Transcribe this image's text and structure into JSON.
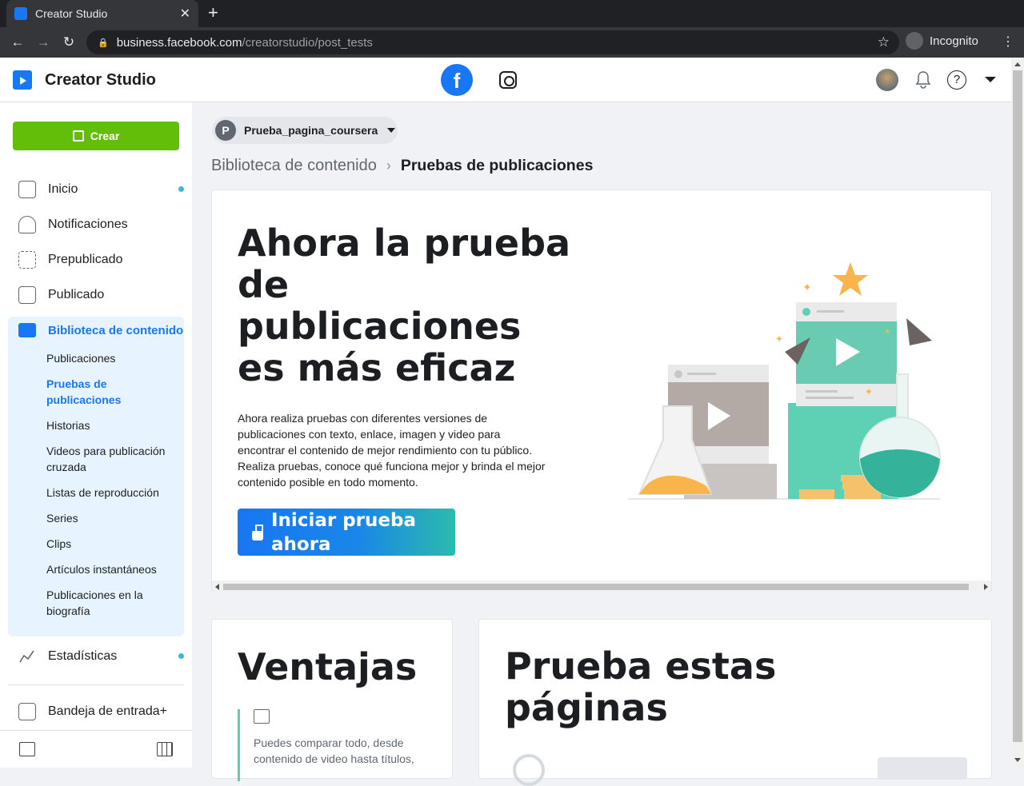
{
  "browser": {
    "tab_title": "Creator Studio",
    "close_glyph": "✕",
    "newtab_glyph": "+",
    "url_host": "business.facebook.com",
    "url_path": "/creatorstudio/post_tests",
    "incognito_label": "Incognito"
  },
  "header": {
    "app_title": "Creator Studio",
    "facebook_glyph": "f",
    "help_glyph": "?"
  },
  "sidebar": {
    "create_label": "Crear",
    "items": [
      {
        "label": "Inicio",
        "icon": "home-icon"
      },
      {
        "label": "Notificaciones",
        "icon": "bell-icon"
      },
      {
        "label": "Prepublicado",
        "icon": "draft-icon"
      },
      {
        "label": "Publicado",
        "icon": "published-icon"
      }
    ],
    "library": {
      "label": "Biblioteca de contenido",
      "subitems": [
        "Publicaciones",
        "Pruebas de publicaciones",
        "Historias",
        "Videos para publicación cruzada",
        "Listas de reproducción",
        "Series",
        "Clips",
        "Artículos instantáneos",
        "Publicaciones en la biografía"
      ]
    },
    "stats_label": "Estadísticas",
    "inbox_label": "Bandeja de entrada+"
  },
  "page_selector": {
    "initial": "P",
    "name": "Prueba_pagina_coursera"
  },
  "breadcrumb": {
    "parent": "Biblioteca de contenido",
    "separator": "›",
    "current": "Pruebas de publicaciones"
  },
  "hero": {
    "title": "Ahora la prueba de publicaciones es más eficaz",
    "body": "Ahora realiza pruebas con diferentes versiones de publicaciones con texto, enlace, imagen y video para encontrar el contenido de mejor rendimiento con tu público. Realiza pruebas, conoce qué funciona mejor y brinda el mejor contenido posible en todo momento.",
    "cta_label": "Iniciar prueba ahora"
  },
  "advantages": {
    "title": "Ventajas",
    "text": "Puedes comparar todo, desde contenido de video hasta títulos,"
  },
  "try_pages": {
    "title": "Prueba estas páginas"
  },
  "colors": {
    "facebook_blue": "#1877f2",
    "create_green": "#63be09",
    "accent_teal": "#5ad0b3",
    "notification_dot": "#3ab7d4"
  }
}
